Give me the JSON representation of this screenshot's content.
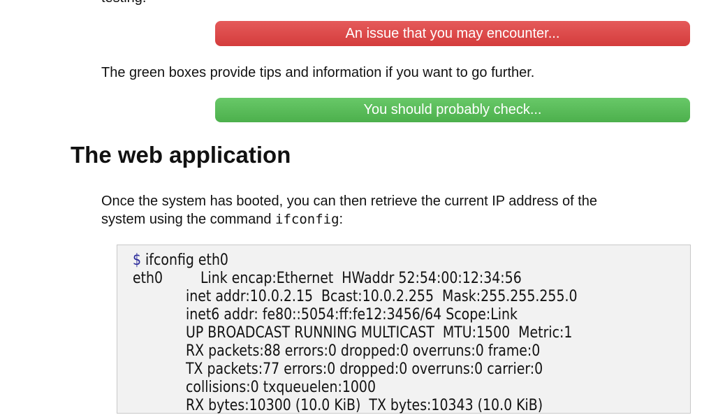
{
  "intro_tail": "testing.",
  "warning_box": "An issue that you may encounter...",
  "green_intro": "The green boxes provide tips and information if you want to go further.",
  "tip_box": "You should probably check...",
  "section_title": "The web application",
  "para1_line1": "Once the system has booted, you can then retrieve the current IP address of the",
  "para1_line2_prefix": "system using the command ",
  "para1_command": "ifconfig",
  "para1_suffix": ":",
  "colors": {
    "warning": "#d94444",
    "tip": "#55b855"
  },
  "terminal": {
    "prompt": "$",
    "command": " ifconfig eth0",
    "iface": "eth0",
    "lines": [
      "Link encap:Ethernet  HWaddr 52:54:00:12:34:56",
      "inet addr:10.0.2.15  Bcast:10.0.2.255  Mask:255.255.255.0",
      "inet6 addr: fe80::5054:ff:fe12:3456/64 Scope:Link",
      "UP BROADCAST RUNNING MULTICAST  MTU:1500  Metric:1",
      "RX packets:88 errors:0 dropped:0 overruns:0 frame:0",
      "TX packets:77 errors:0 dropped:0 overruns:0 carrier:0",
      "collisions:0 txqueuelen:1000",
      "RX bytes:10300 (10.0 KiB)  TX bytes:10343 (10.0 KiB)"
    ]
  }
}
